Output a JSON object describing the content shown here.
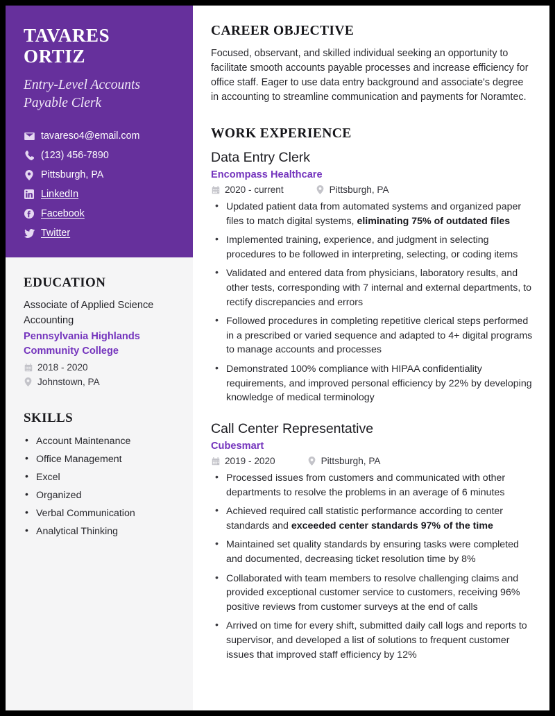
{
  "theme": {
    "header_purple": "#66309C",
    "accent_purple": "#7434BD",
    "sidebar_bg": "#F5F5F6",
    "page_border": "#000000",
    "text_dark": "#26262B"
  },
  "sidebar": {
    "name": "Tavares Ortiz",
    "job_title": "Entry-Level Accounts Payable Clerk",
    "contact": [
      {
        "icon": "envelope-icon",
        "text": "tavareso4@email.com",
        "link": false
      },
      {
        "icon": "phone-icon",
        "text": "(123) 456-7890",
        "link": false
      },
      {
        "icon": "map-pin-icon",
        "text": "Pittsburgh, PA",
        "link": false
      },
      {
        "icon": "linkedin-icon",
        "text": "LinkedIn",
        "link": true
      },
      {
        "icon": "facebook-icon",
        "text": "Facebook",
        "link": true
      },
      {
        "icon": "twitter-icon",
        "text": "Twitter",
        "link": true
      }
    ],
    "education": {
      "heading": "Education",
      "degree": "Associate of Applied Science",
      "major": "Accounting",
      "school": "Pennsylvania Highlands Community College",
      "dates": "2018 - 2020",
      "location": "Johnstown, PA"
    },
    "skills": {
      "heading": "Skills",
      "items": [
        "Account Maintenance",
        "Office Management",
        "Excel",
        "Organized",
        "Verbal Communication",
        "Analytical Thinking"
      ]
    }
  },
  "main": {
    "objective": {
      "heading": "Career Objective",
      "text": "Focused, observant, and skilled individual seeking an opportunity to facilitate smooth accounts payable processes and increase efficiency for office staff. Eager to use data entry background and associate's degree in accounting to streamline communication and payments for Noramtec."
    },
    "work": {
      "heading": "Work Experience",
      "jobs": [
        {
          "title": "Data Entry Clerk",
          "organization": "Encompass Healthcare",
          "dates": "2020 - current",
          "location": "Pittsburgh, PA",
          "bullets": [
            {
              "pre": "Updated patient data from automated systems and organized paper files to match digital systems, ",
              "bold": "eliminating 75% of outdated files",
              "post": ""
            },
            {
              "pre": "Implemented training, experience, and judgment in selecting procedures to be followed in interpreting, selecting, or coding items",
              "bold": "",
              "post": ""
            },
            {
              "pre": "Validated and entered data from physicians, laboratory results, and other tests, corresponding with 7 internal and external departments, to rectify discrepancies and errors",
              "bold": "",
              "post": ""
            },
            {
              "pre": "Followed procedures in completing repetitive clerical steps performed in a prescribed or varied sequence and adapted to 4+ digital programs to manage accounts and processes",
              "bold": "",
              "post": ""
            },
            {
              "pre": "Demonstrated 100% compliance with HIPAA confidentiality requirements, and improved personal efficiency by 22% by developing knowledge of medical terminology",
              "bold": "",
              "post": ""
            }
          ]
        },
        {
          "title": "Call Center Representative",
          "organization": "Cubesmart",
          "dates": "2019 - 2020",
          "location": "Pittsburgh, PA",
          "bullets": [
            {
              "pre": "Processed issues from customers and communicated with other departments to resolve the problems in an average of 6 minutes",
              "bold": "",
              "post": ""
            },
            {
              "pre": "Achieved required call statistic performance according to center standards and ",
              "bold": "exceeded center standards 97% of the time",
              "post": ""
            },
            {
              "pre": "Maintained set quality standards by ensuring tasks were completed and documented, decreasing ticket resolution time by 8%",
              "bold": "",
              "post": ""
            },
            {
              "pre": "Collaborated with team members to resolve challenging claims and provided exceptional customer service to customers, receiving 96% positive reviews from customer surveys at the end of calls",
              "bold": "",
              "post": ""
            },
            {
              "pre": "Arrived on time for every shift, submitted daily call logs and reports to supervisor, and developed a list of solutions to frequent customer issues that improved staff efficiency by 12%",
              "bold": "",
              "post": ""
            }
          ]
        }
      ]
    }
  }
}
